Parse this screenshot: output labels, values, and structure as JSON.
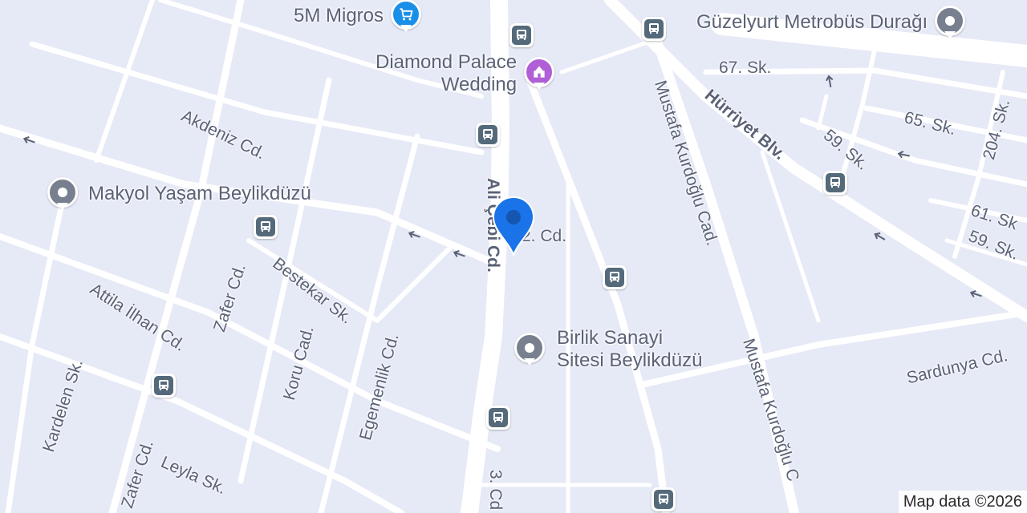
{
  "map": {
    "colors": {
      "background": "#e6e9f6",
      "road": "#ffffff",
      "label": "#5a6276",
      "marker": "#1a73e8",
      "marker_dot": "#1557b0",
      "poi_gray": "#78808f",
      "shop_blue": "#1a8fe8",
      "wedding_purple": "#b05fd6",
      "bus_stop": "#546a7b"
    },
    "streets": {
      "akdeniz": "Akdeniz Cd.",
      "ali_cebi": "Ali Çebi Cd.",
      "partial_cd": "2. Cd.",
      "bestekar": "Bestekar Sk.",
      "attila_ilhan": "Attila İlhan Cd.",
      "zafer_upper": "Zafer Cd.",
      "zafer_lower": "Zafer Cd.",
      "koru": "Koru Cad.",
      "egemenlik": "Egemenlik Cd.",
      "kardelen": "Kardelen Sk.",
      "leyla": "Leyla Sk.",
      "mustafa_upper": "Mustafa Kurdoğlu Cad.",
      "mustafa_lower": "Mustafa Kurdoğlu C",
      "hurriyet": "Hürriyet Blv.",
      "sk67": "67. Sk.",
      "sk65": "65. Sk.",
      "sk59a": "59. Sk.",
      "sk59b": "59. Sk.",
      "sk61": "61. Sk",
      "sk204": "204. Sk.",
      "sardunya": "Sardunya Cd.",
      "cd3": "3. Cd"
    },
    "places": {
      "migros": {
        "name": "5M Migros",
        "icon": "shopping-cart-icon"
      },
      "diamond": {
        "line1": "Diamond Palace",
        "line2": "Wedding",
        "icon": "wedding-hall-icon"
      },
      "guzelyurt": {
        "name": "Güzelyurt Metrobüs Durağı",
        "icon": "place-pin-icon"
      },
      "makyol": {
        "name": "Makyol Yaşam Beylikdüzü",
        "icon": "place-pin-icon"
      },
      "birlik": {
        "line1": "Birlik Sanayi",
        "line2": "Sitesi Beylikdüzü",
        "icon": "place-pin-icon"
      }
    },
    "attribution": "Map data ©2026"
  }
}
